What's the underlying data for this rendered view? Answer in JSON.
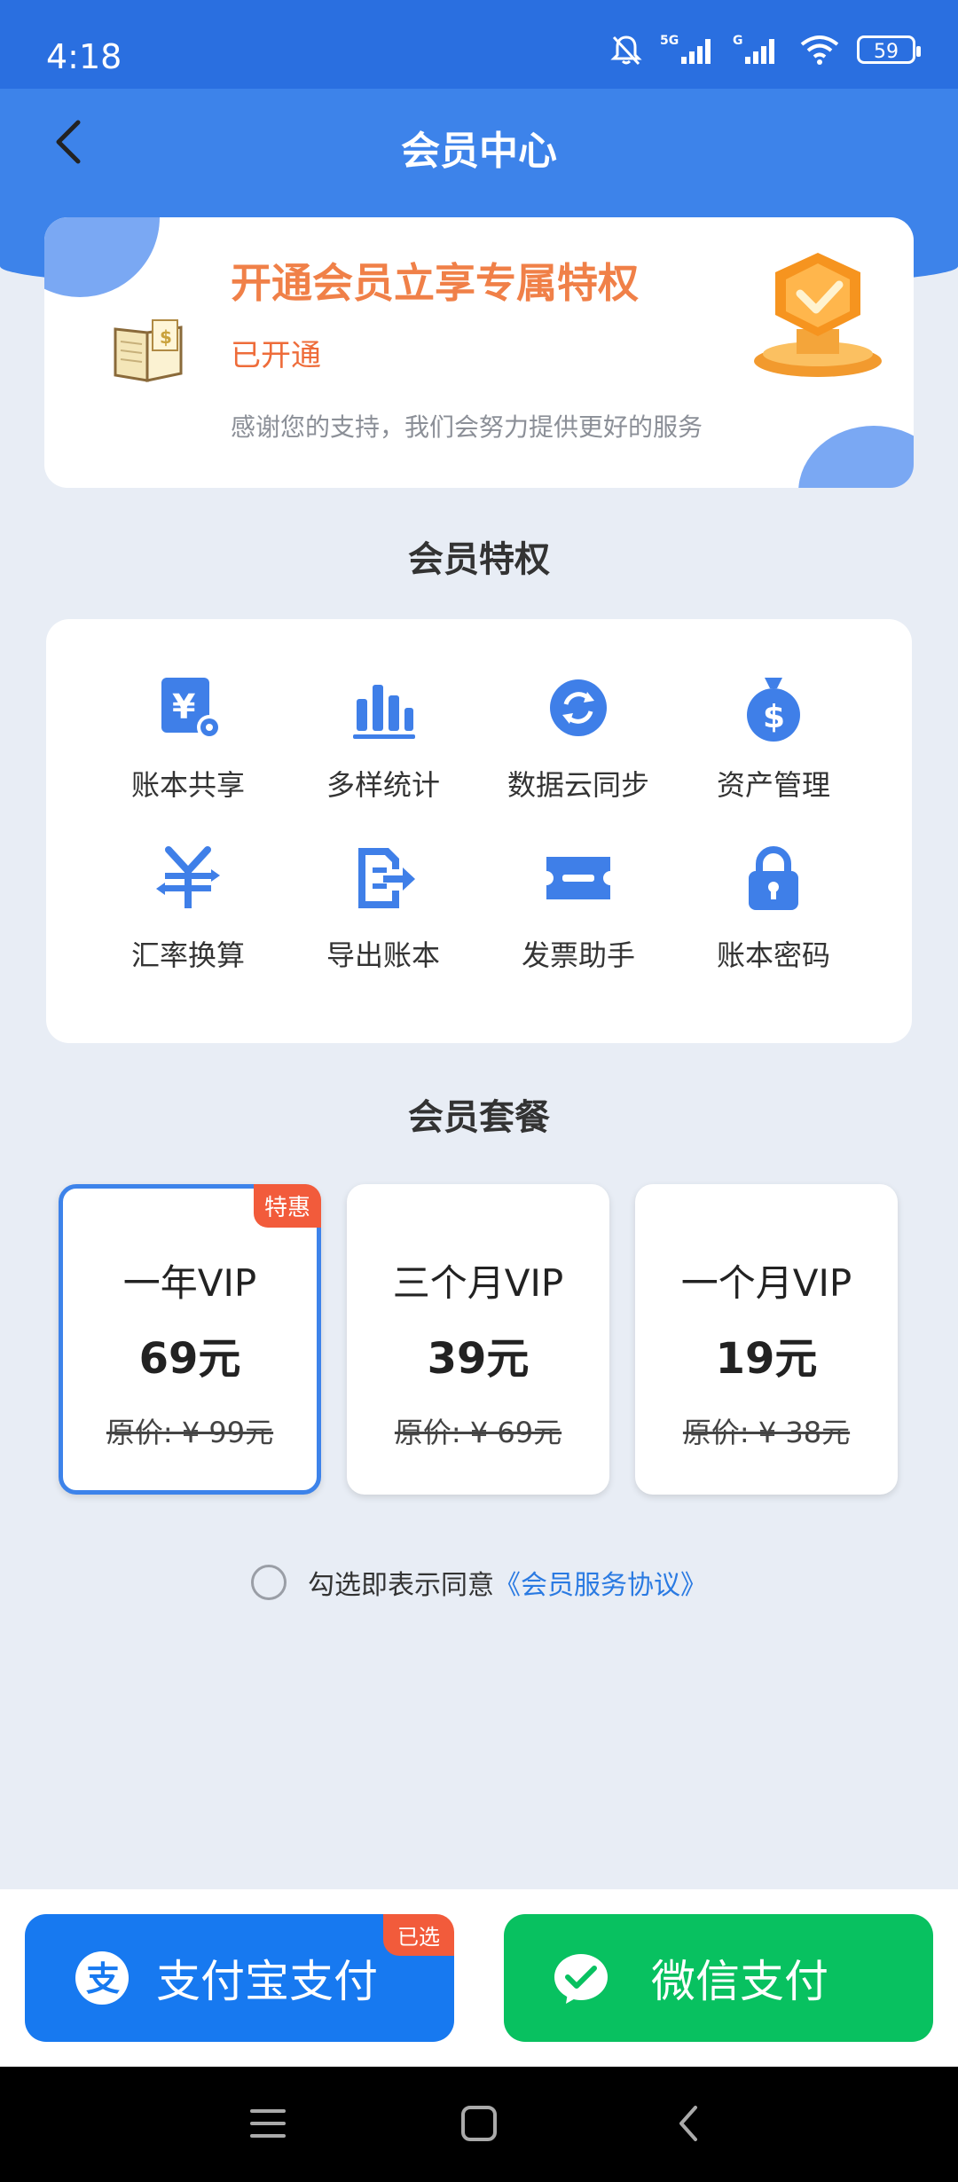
{
  "status": {
    "time": "4:18",
    "battery": "59",
    "network1": "5G",
    "network2": "G"
  },
  "nav": {
    "title": "会员中心"
  },
  "vip": {
    "title": "开通会员立享专属特权",
    "status": "已开通",
    "desc": "感谢您的支持，我们会努力提供更好的服务"
  },
  "privileges": {
    "title": "会员特权",
    "items": [
      {
        "label": "账本共享",
        "icon": "shared-book-icon"
      },
      {
        "label": "多样统计",
        "icon": "bar-chart-icon"
      },
      {
        "label": "数据云同步",
        "icon": "cloud-sync-icon"
      },
      {
        "label": "资产管理",
        "icon": "money-bag-icon"
      },
      {
        "label": "汇率换算",
        "icon": "currency-exchange-icon"
      },
      {
        "label": "导出账本",
        "icon": "export-icon"
      },
      {
        "label": "发票助手",
        "icon": "ticket-icon"
      },
      {
        "label": "账本密码",
        "icon": "lock-icon"
      }
    ]
  },
  "plans": {
    "title": "会员套餐",
    "promo_tag": "特惠",
    "items": [
      {
        "name": "一年VIP",
        "price": "69元",
        "original": "原价: ¥ 99元",
        "selected": true
      },
      {
        "name": "三个月VIP",
        "price": "39元",
        "original": "原价: ¥ 69元",
        "selected": false
      },
      {
        "name": "一个月VIP",
        "price": "19元",
        "original": "原价: ¥ 38元",
        "selected": false
      }
    ]
  },
  "agreement": {
    "text": "勾选即表示同意",
    "link": "《会员服务协议》"
  },
  "payment": {
    "alipay_label": "支付宝支付",
    "wechat_label": "微信支付",
    "selected_tag": "已选"
  },
  "colors": {
    "primary": "#3d83ea",
    "accent": "#f08048",
    "alipay": "#1779f0",
    "wechat": "#08c160",
    "tag": "#f25b3b"
  }
}
